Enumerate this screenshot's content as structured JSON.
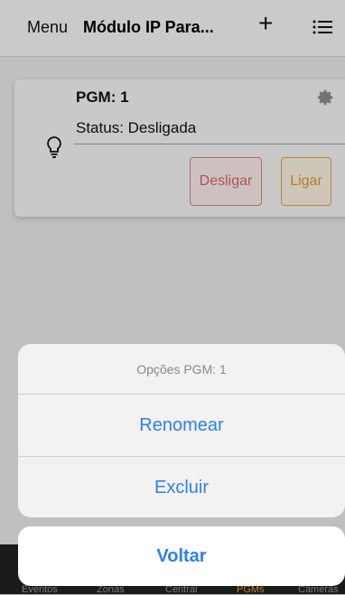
{
  "navbar": {
    "menu_label": "Menu",
    "title": "Módulo IP Para...",
    "add_icon": "plus-icon",
    "list_icon": "list-icon"
  },
  "card": {
    "title": "PGM: 1",
    "status": "Status: Desligada",
    "gear_icon": "gear-icon",
    "bulb_icon": "lightbulb-icon",
    "off_label": "Desligar",
    "on_label": "Ligar"
  },
  "tabbar": {
    "tabs": [
      {
        "label": "Eventos"
      },
      {
        "label": "Zonas"
      },
      {
        "label": "Central"
      },
      {
        "label": "PGMs",
        "active": true
      },
      {
        "label": "Câmeras"
      }
    ]
  },
  "action_sheet": {
    "title": "Opções PGM: 1",
    "rename_label": "Renomear",
    "delete_label": "Excluir",
    "cancel_label": "Voltar"
  },
  "colors": {
    "accent": "#2d7ff5",
    "off_button": "#d26a6a",
    "on_button": "#e09a2a",
    "active_tab": "#e6a23a"
  }
}
